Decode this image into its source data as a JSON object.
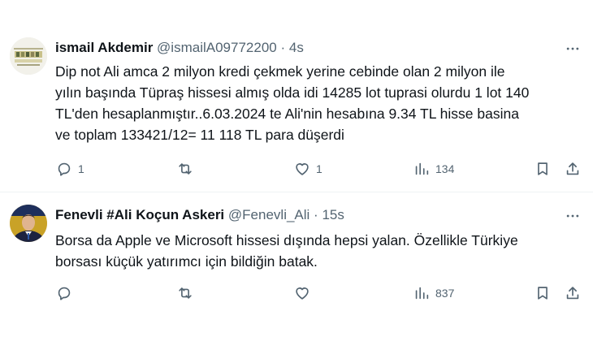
{
  "tweets": [
    {
      "name": "ismail Akdemir",
      "handle": "@ismailA09772200",
      "separator": "·",
      "time": "4s",
      "text": "Dip not Ali amca 2 milyon kredi çekmek yerine cebinde olan 2 milyon ile\nyılın başında Tüpraş hissesi almış olda idi 14285 lot tuprasi olurdu 1 lot 140\nTL'den hesaplanmıştır..6.03.2024 te Ali'nin hesabına 9.34 TL hisse basina\nve toplam 133421/12= 11 118 TL para düşerdi",
      "replies": "1",
      "reposts": "",
      "likes": "1",
      "views": "134"
    },
    {
      "name": "Fenevli #Ali Koçun Askeri",
      "handle": "@Fenevli_Ali",
      "separator": "·",
      "time": "15s",
      "text": "Borsa da Apple ve Microsoft hissesi dışında hepsi yalan. Özellikle Türkiye\nborsası küçük yatırımcı için bildiğin batak.",
      "replies": "",
      "reposts": "",
      "likes": "",
      "views": "837"
    }
  ],
  "colors": {
    "text": "#0f1419",
    "secondary": "#536471",
    "divider": "#eff3f4"
  },
  "icons": [
    "more-icon",
    "reply-icon",
    "repost-icon",
    "like-icon",
    "views-icon",
    "bookmark-icon",
    "share-icon"
  ]
}
